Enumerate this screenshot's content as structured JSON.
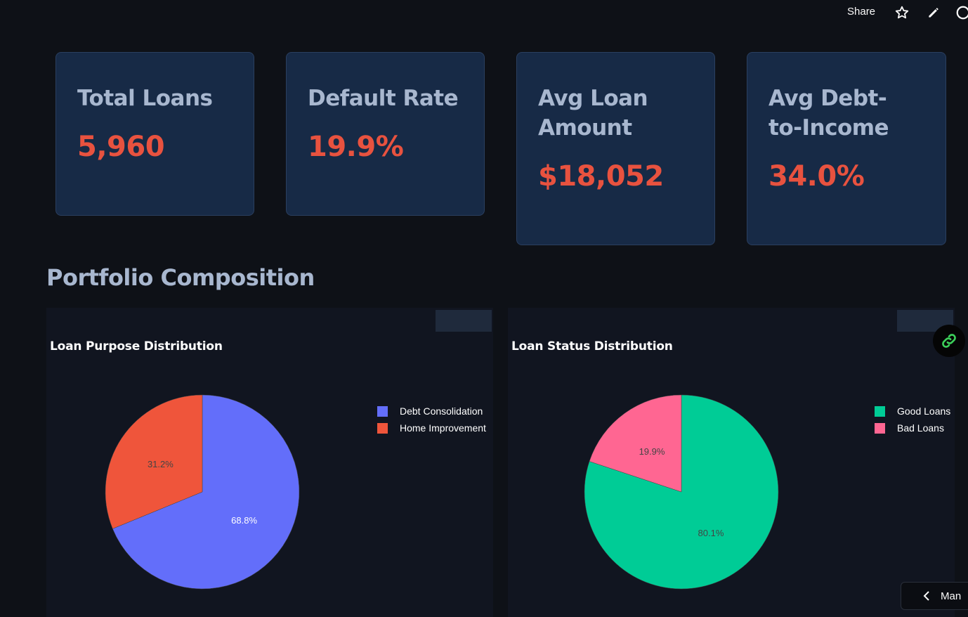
{
  "toolbar": {
    "share_label": "Share",
    "icons": [
      "star-icon",
      "pencil-icon",
      "github-icon"
    ]
  },
  "kpis": [
    {
      "label": "Total Loans",
      "value": "5,960"
    },
    {
      "label": "Default Rate",
      "value": "19.9%"
    },
    {
      "label": "Avg Loan Amount",
      "value": "$18,052"
    },
    {
      "label": "Avg Debt-to-Income",
      "value": "34.0%"
    }
  ],
  "section": {
    "title": "Portfolio Composition"
  },
  "colors": {
    "background": "#0e1117",
    "card_bg": "#172a46",
    "accent_value": "#e8523f",
    "debt_consolidation": "#636efa",
    "home_improvement": "#ef553b",
    "good_loans": "#00cc96",
    "bad_loans": "#ff6692"
  },
  "chart_data": [
    {
      "type": "pie",
      "title": "Loan Purpose Distribution",
      "categories": [
        "Debt Consolidation",
        "Home Improvement"
      ],
      "values": [
        68.8,
        31.2
      ],
      "labels": [
        "68.8%",
        "31.2%"
      ],
      "colors": [
        "#636efa",
        "#ef553b"
      ],
      "legend": "top-right"
    },
    {
      "type": "pie",
      "title": "Loan Status Distribution",
      "categories": [
        "Good Loans",
        "Bad Loans"
      ],
      "values": [
        80.1,
        19.9
      ],
      "labels": [
        "80.1%",
        "19.9%"
      ],
      "colors": [
        "#00cc96",
        "#ff6692"
      ],
      "legend": "top-right"
    }
  ],
  "bottom": {
    "manage_label": "Man"
  }
}
